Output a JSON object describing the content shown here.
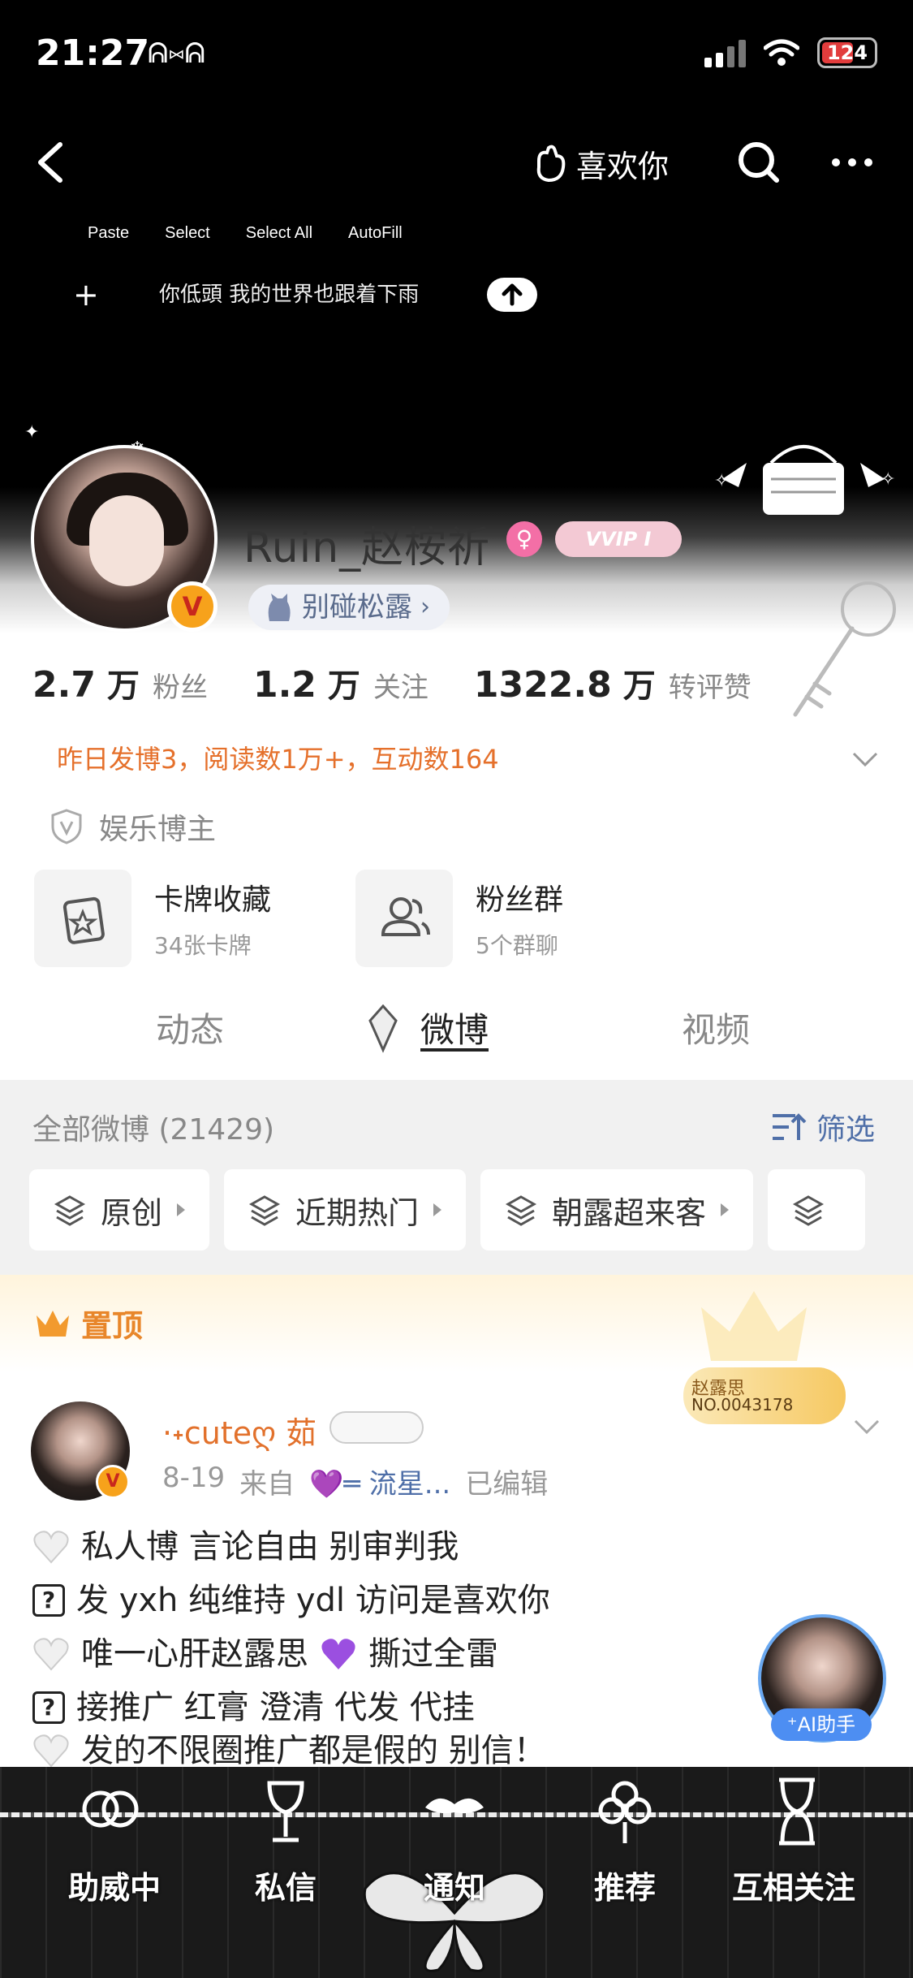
{
  "status_bar": {
    "time": "21:27",
    "emoji": "ᕱ⑅ᕱ",
    "battery": "124"
  },
  "top_nav": {
    "like_you": "喜欢你"
  },
  "text_menu": [
    "Paste",
    "Select",
    "Select All",
    "AutoFill"
  ],
  "input_draft": "你低頭 我的世界也跟着下雨",
  "profile": {
    "username": "Ruin_赵桉祈",
    "vip_badge": "VVIP I",
    "tag": "别碰松露",
    "stats": [
      {
        "num": "2.7",
        "unit": "万",
        "label": "粉丝"
      },
      {
        "num": "1.2",
        "unit": "万",
        "label": "关注"
      },
      {
        "num": "1322.8",
        "unit": "万",
        "label": "转评赞"
      }
    ],
    "yesterday": "昨日发博3，阅读数1万+，互动数164",
    "certification": "娱乐博主",
    "cards": [
      {
        "title": "卡牌收藏",
        "sub": "34张卡牌"
      },
      {
        "title": "粉丝群",
        "sub": "5个群聊"
      }
    ]
  },
  "tabs": [
    "动态",
    "微博",
    "视频"
  ],
  "feed": {
    "all_label": "全部微博 (21429)",
    "filter": "筛选",
    "chips": [
      "原创",
      "近期热门",
      "朝露超来客"
    ],
    "pinned": "置顶",
    "fans_card": {
      "name": "赵露思",
      "no": "NO.0043178"
    },
    "post": {
      "author": "·˖cuteღ 茹",
      "date": "8-19",
      "from": "来自",
      "source": "💜═ 流星...",
      "edited": "已编辑",
      "lines": [
        "私人博 言论自由 别审判我",
        "发 yxh 纯维持 ydl 访问是喜欢你",
        "唯一心肝赵露思",
        "撕过全雷",
        "接推广 红膏 澄清 代发 代挂",
        "发的不限圈推广都是假的 别信！"
      ]
    },
    "ai_label": "⁺AI助手"
  },
  "bottom_tabs": [
    "助威中",
    "私信",
    "通知",
    "推荐",
    "互相关注"
  ],
  "colors": {
    "accent_orange": "#e5702b",
    "link_blue": "#4f6fa8",
    "vip_pink": "#f3c9d4"
  }
}
